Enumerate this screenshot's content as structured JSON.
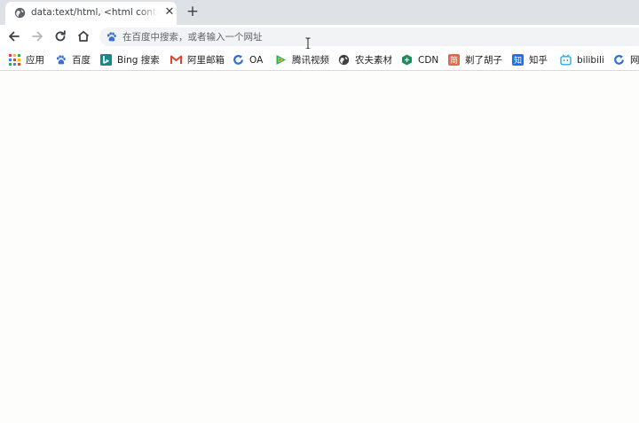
{
  "tab": {
    "title": "data:text/html, <html contenteditable>",
    "close": "✕",
    "new_tab": "+"
  },
  "omnibox": {
    "placeholder": "在百度中搜索，或者输入一个网址",
    "value": ""
  },
  "bookmarks": [
    {
      "label": "应用",
      "icon": "apps-grid-icon"
    },
    {
      "label": "百度",
      "icon": "baidu-paw-icon",
      "color": "#3b6fd9"
    },
    {
      "label": "Bing 搜索",
      "icon": "bing-icon",
      "color": "#138a8a"
    },
    {
      "label": "阿里邮箱",
      "icon": "aliyun-mail-icon",
      "color": "#e0452b"
    },
    {
      "label": "OA",
      "icon": "oa-refresh-icon",
      "color": "#2b6fd6"
    },
    {
      "label": "腾讯视频",
      "icon": "tencent-video-icon",
      "color": "#28b34a"
    },
    {
      "label": "农夫素材",
      "icon": "globe-icon",
      "color": "#3c4043"
    },
    {
      "label": "CDN",
      "icon": "cdn-hex-icon",
      "color": "#1a8f5a"
    },
    {
      "label": "剃了胡子",
      "icon": "jian-icon",
      "color": "#e8664a"
    },
    {
      "label": "知乎",
      "icon": "zhihu-icon",
      "color": "#1772f6"
    },
    {
      "label": "bilibili",
      "icon": "bilibili-tv-icon",
      "color": "#23ade5"
    },
    {
      "label": "网",
      "icon": "web-refresh-icon",
      "color": "#2b6fd6"
    }
  ]
}
